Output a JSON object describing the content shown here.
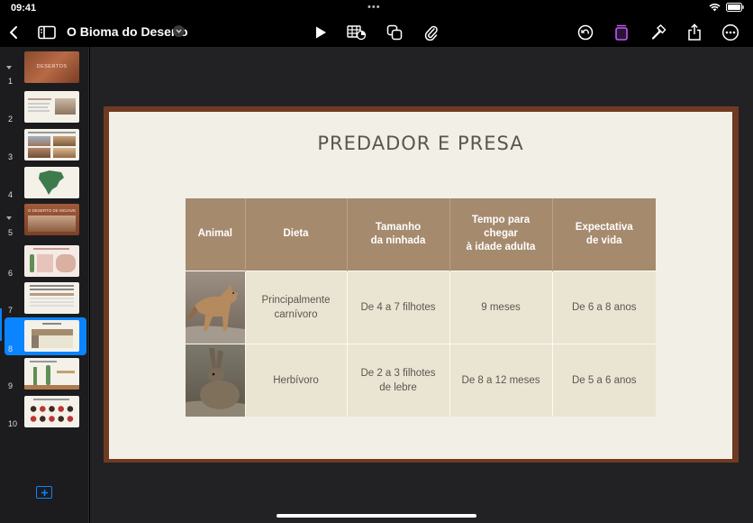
{
  "status": {
    "time": "09:41",
    "dots": "•••"
  },
  "toolbar": {
    "title": "O Bioma do Deserto",
    "icons": [
      "back-icon",
      "sidebar-icon",
      "play-icon",
      "table-chart-icon",
      "shapes-icon",
      "paperclip-icon",
      "undo-icon",
      "format-icon",
      "hammer-icon",
      "share-icon",
      "more-icon"
    ],
    "accent": "#bf5af2"
  },
  "sidebar": {
    "slides": [
      {
        "num": "1",
        "label": "DESERTOS"
      },
      {
        "num": "2"
      },
      {
        "num": "3"
      },
      {
        "num": "4"
      },
      {
        "num": "5",
        "label": "O DESERTO DE MOJAVE"
      },
      {
        "num": "6"
      },
      {
        "num": "7"
      },
      {
        "num": "8",
        "selected": true
      },
      {
        "num": "9"
      },
      {
        "num": "10"
      }
    ],
    "selection_color": "#0a84ff"
  },
  "slide": {
    "title": "PREDADOR E PRESA",
    "table": {
      "headers": [
        "Animal",
        "Dieta",
        "Tamanho\nda ninhada",
        "Tempo para chegar\nà idade adulta",
        "Expectativa\nde vida"
      ],
      "rows": [
        {
          "image": "coyote-photo",
          "diet": "Principalmente\ncarnívoro",
          "litter": "De 4 a 7 filhotes",
          "adult": "9 meses",
          "life": "De 6 a 8 anos"
        },
        {
          "image": "jackrabbit-photo",
          "diet": "Herbívoro",
          "litter": "De 2 a 3 filhotes\nde lebre",
          "adult": "De 8 a 12 meses",
          "life": "De 5 a 6 anos"
        }
      ],
      "header_color": "#a58a6e",
      "cell_color": "#e9e5d2"
    }
  }
}
